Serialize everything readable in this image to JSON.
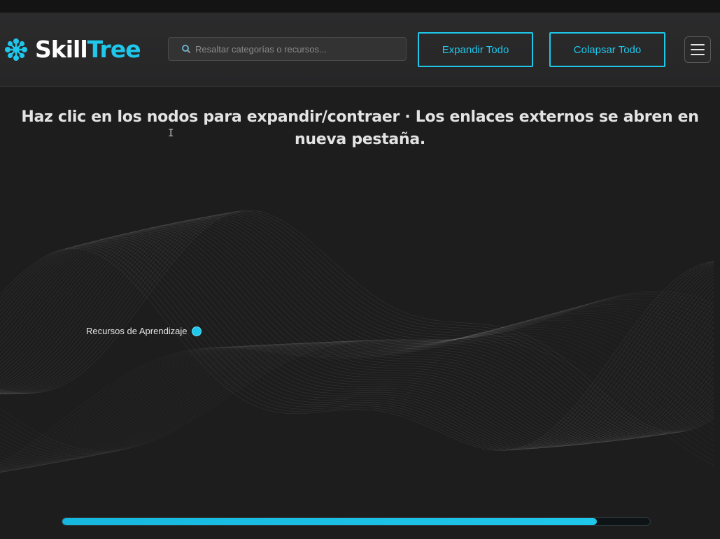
{
  "header": {
    "logo_part1": "Skill",
    "logo_part2": "Tree",
    "search_placeholder": "Resaltar categorías o recursos...",
    "expand_label": "Expandir Todo",
    "collapse_label": "Colapsar Todo",
    "menu_icon": "hamburger-menu-icon",
    "search_icon": "search-icon",
    "logo_icon": "snowflake-logo-icon"
  },
  "main": {
    "instructions": "Haz clic en los nodos para expandir/contraer · Los enlaces externos se abren en nueva pestaña.",
    "root_node": "Recursos de Aprendizaje"
  },
  "progress": {
    "value": 0.91
  },
  "colors": {
    "accent": "#1fc7ea",
    "background": "#1d1d1e",
    "navbar": "#282829"
  }
}
